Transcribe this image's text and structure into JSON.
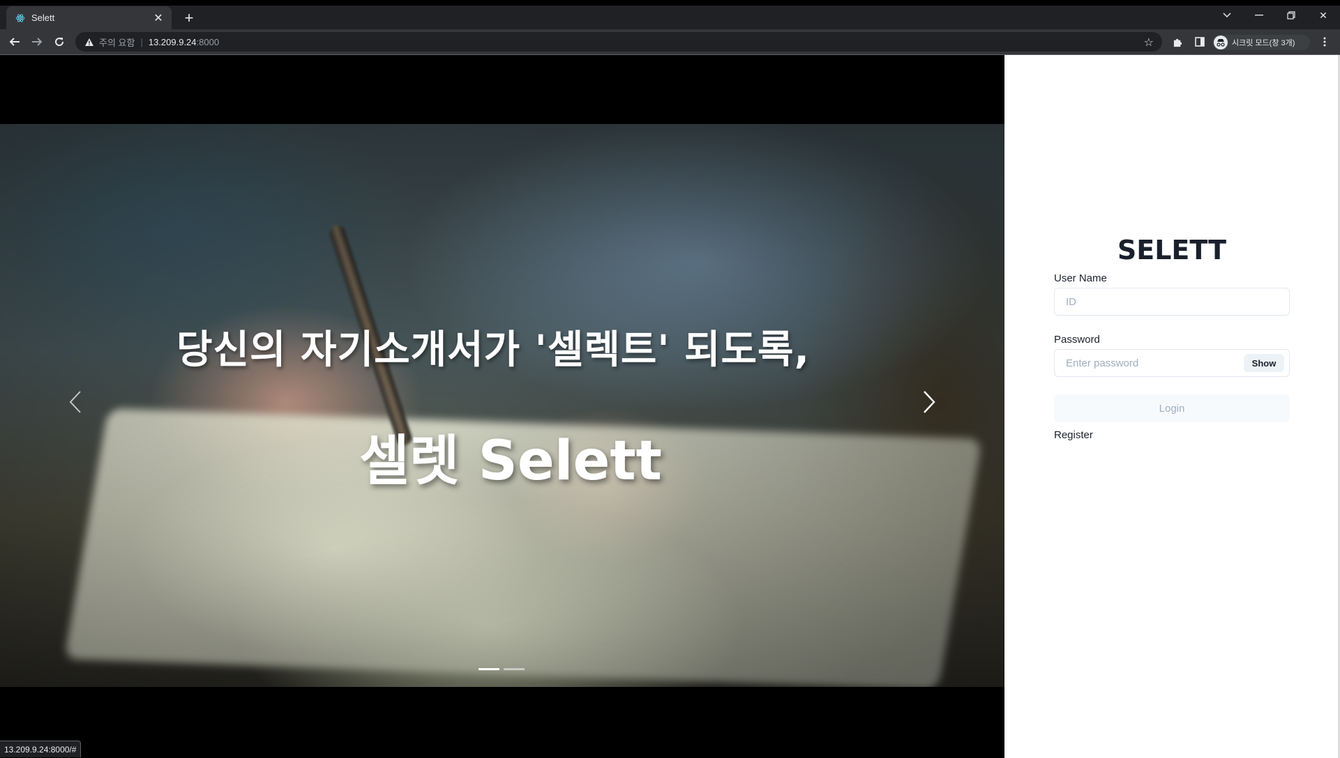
{
  "browser": {
    "tab_title": "Selett",
    "new_tab_label": "+",
    "security_warning": "주의 요함",
    "url_host": "13.209.9.24",
    "url_port": ":8000",
    "incognito_label": "시크릿 모드(창 3개)",
    "status_url": "13.209.9.24:8000/#"
  },
  "hero": {
    "headline": "당신의 자기소개서가 '셀렉트' 되도록,",
    "subheadline": "셀렛 Selett",
    "slide_count": 2,
    "active_slide": 1
  },
  "login": {
    "title": "SELETT",
    "username_label": "User Name",
    "username_placeholder": "ID",
    "password_label": "Password",
    "password_placeholder": "Enter password",
    "show_button": "Show",
    "login_button": "Login",
    "register_link": "Register"
  },
  "colors": {
    "chrome_dark": "#202124",
    "chrome_toolbar": "#35363a",
    "panel_bg": "#ffffff",
    "text_dark": "#1a202c",
    "muted": "#a0aec0"
  }
}
